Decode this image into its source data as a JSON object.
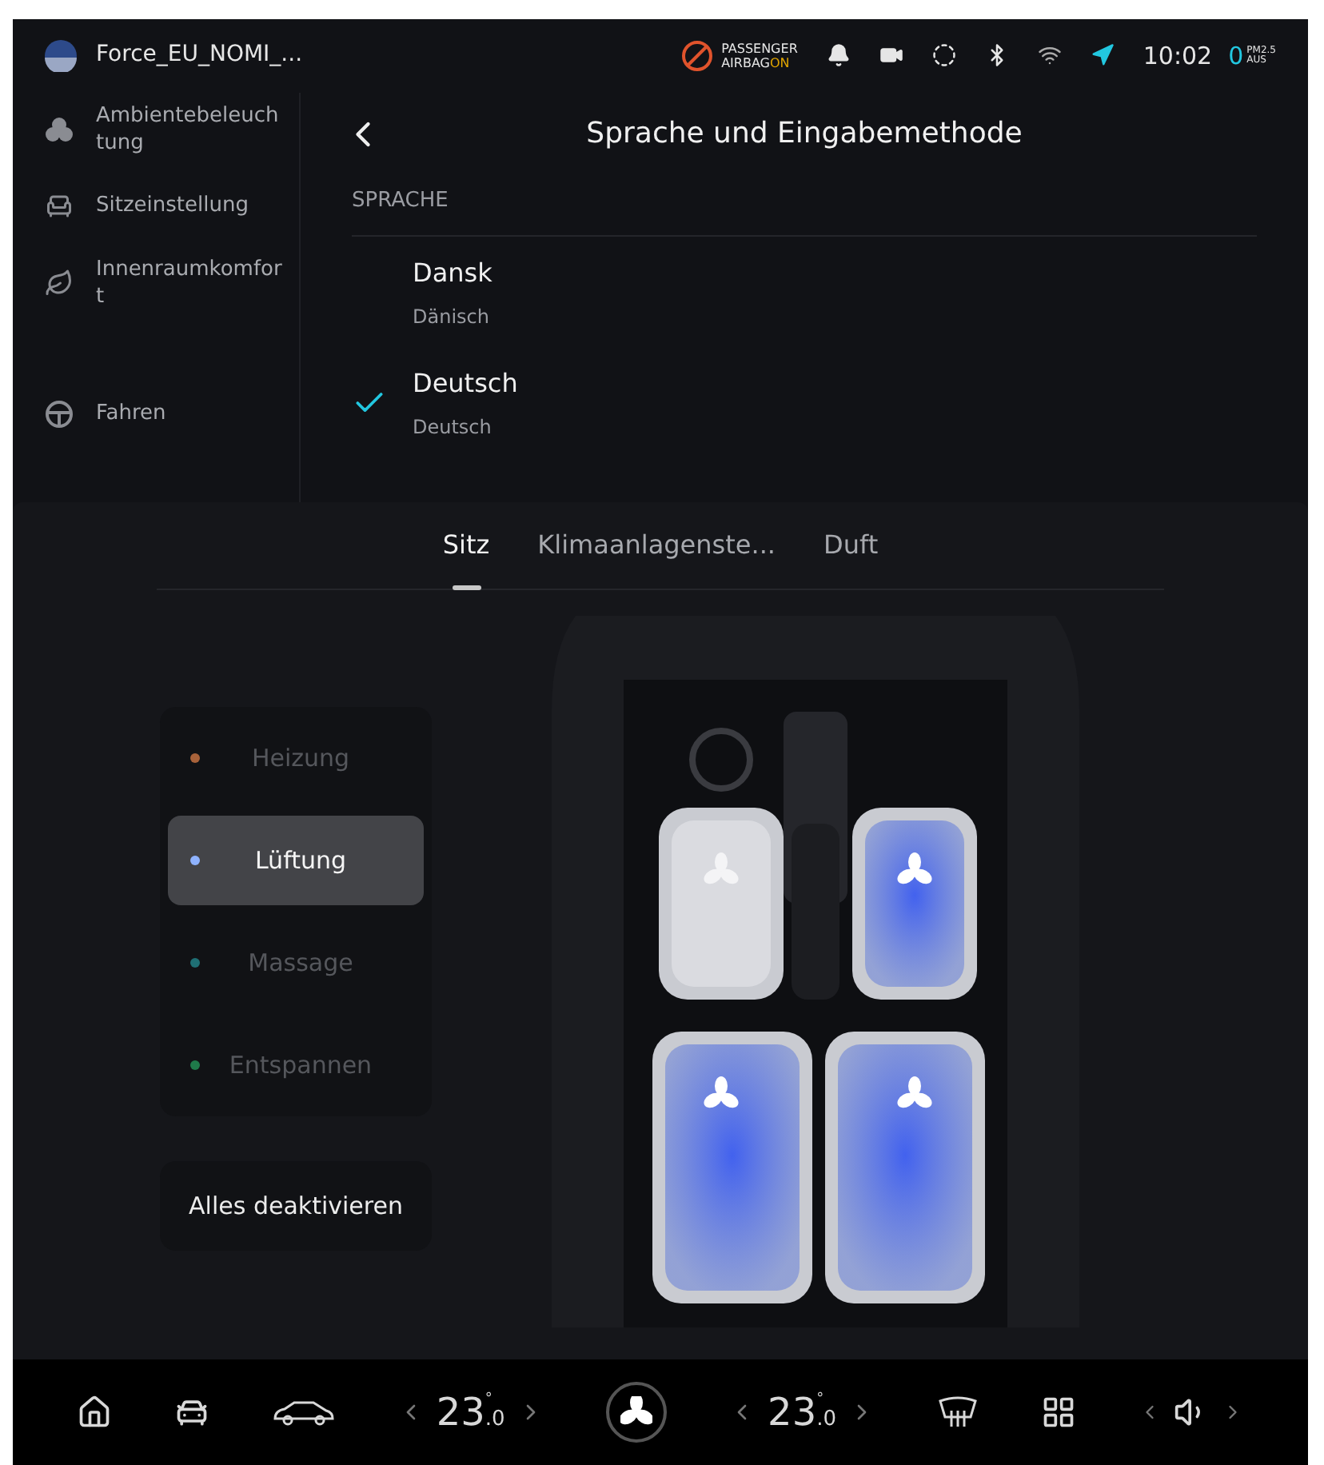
{
  "status_bar": {
    "profile_name": "Force_EU_NOMI_...",
    "airbag": {
      "line1": "PASSENGER",
      "line2": "AIRBAG",
      "state": "ON"
    },
    "time": "10:02",
    "air_quality": {
      "value": "0",
      "label": "PM2.5",
      "sublabel": "AUS"
    }
  },
  "sidebar": {
    "items": [
      {
        "label": "Ambientebeleuchtung",
        "kind": "light"
      },
      {
        "label": "Sitzeinstellung",
        "kind": "seat"
      },
      {
        "label": "Innenraumkomfort",
        "kind": "leaf"
      },
      {
        "label": "Fahren",
        "kind": "wheel"
      }
    ]
  },
  "settings": {
    "title": "Sprache und Eingabemethode",
    "section": "SPRACHE",
    "languages": [
      {
        "name": "Dansk",
        "subtitle": "Dänisch",
        "selected": false
      },
      {
        "name": "Deutsch",
        "subtitle": "Deutsch",
        "selected": true
      }
    ]
  },
  "panel": {
    "tabs": [
      {
        "label": "Sitz",
        "selected": true
      },
      {
        "label": "Klimaanlagenste...",
        "selected": false
      },
      {
        "label": "Duft",
        "selected": false
      }
    ],
    "modes": [
      {
        "label": "Heizung",
        "color": "#a8623a",
        "selected": false
      },
      {
        "label": "Lüftung",
        "color": "#8fb3ff",
        "selected": true
      },
      {
        "label": "Massage",
        "color": "#1f6f74",
        "selected": false
      },
      {
        "label": "Entspannen",
        "color": "#1f7a4a",
        "selected": false
      }
    ],
    "deactivate_button": "Alles deaktivieren",
    "seats": [
      {
        "active": false
      },
      {
        "active": true
      },
      {
        "active": true
      },
      {
        "active": true
      }
    ]
  },
  "dock": {
    "left_temp": {
      "whole": "23",
      "decimal": ".0",
      "unit": "°"
    },
    "right_temp": {
      "whole": "23",
      "decimal": ".0",
      "unit": "°"
    }
  }
}
